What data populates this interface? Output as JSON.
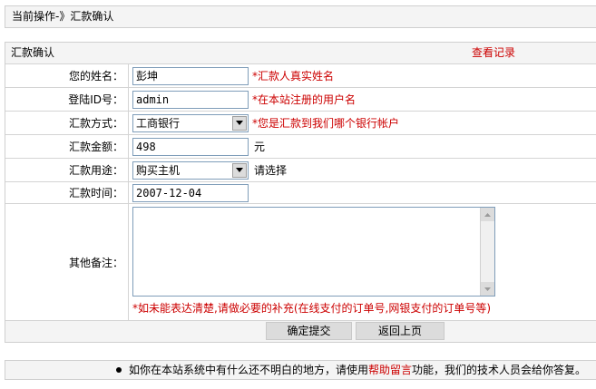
{
  "breadcrumb": {
    "text": "当前操作-》汇款确认"
  },
  "form": {
    "header_title": "汇款确认",
    "view_records": "查看记录",
    "name": {
      "label": "您的姓名：",
      "value": "彭坤",
      "hint": "*汇款人真实姓名"
    },
    "login_id": {
      "label": "登陆ID号：",
      "value": "admin",
      "hint": "*在本站注册的用户名"
    },
    "method": {
      "label": "汇款方式：",
      "value": "工商银行",
      "hint": "*您是汇款到我们哪个银行帐户"
    },
    "amount": {
      "label": "汇款金额：",
      "value": "498",
      "unit": "元"
    },
    "purpose": {
      "label": "汇款用途：",
      "value": "购买主机",
      "hint": "请选择"
    },
    "time": {
      "label": "汇款时间：",
      "value": "2007-12-04"
    },
    "remarks": {
      "label": "其他备注：",
      "note": "*如未能表达清楚,请做必要的补充(在线支付的订单号,网银支付的订单号等)"
    },
    "submit": "确定提交",
    "back": "返回上页"
  },
  "footer": {
    "prefix": "如你在本站系统中有什么还不明白的地方，请使用",
    "link": "帮助留言",
    "suffix": "功能，我们的技术人员会给你答复。"
  }
}
